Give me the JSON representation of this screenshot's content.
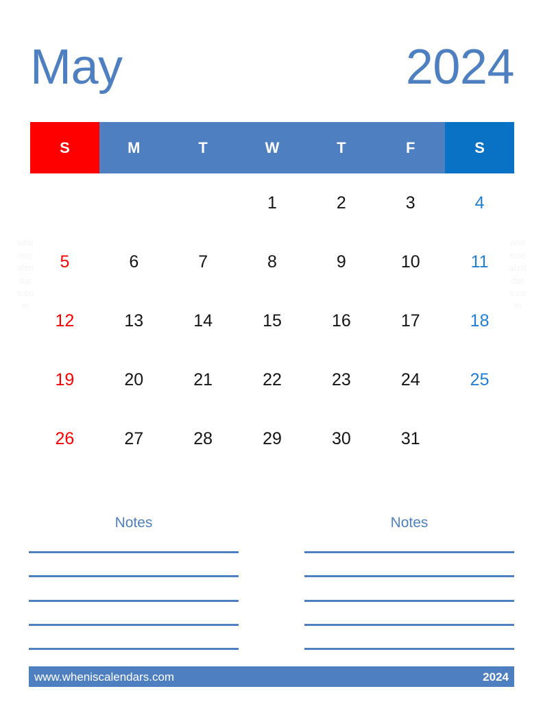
{
  "title": {
    "month": "May",
    "year": "2024"
  },
  "colors": {
    "primary_blue": "#4E7FC1",
    "saturday_header_blue": "#0A72C4",
    "sunday_red": "#FF0000",
    "saturday_text_blue": "#1E7FD4",
    "weekday_text": "#141414",
    "watermark": "#F4F4F4"
  },
  "weekdays": [
    {
      "label": "S",
      "kind": "sun"
    },
    {
      "label": "M",
      "kind": "weekday"
    },
    {
      "label": "T",
      "kind": "weekday"
    },
    {
      "label": "W",
      "kind": "weekday"
    },
    {
      "label": "T",
      "kind": "weekday"
    },
    {
      "label": "F",
      "kind": "weekday"
    },
    {
      "label": "S",
      "kind": "sat"
    }
  ],
  "weeks": [
    [
      {
        "day": "",
        "kind": "empty"
      },
      {
        "day": "",
        "kind": "empty"
      },
      {
        "day": "",
        "kind": "empty"
      },
      {
        "day": "1",
        "kind": "weekday"
      },
      {
        "day": "2",
        "kind": "weekday"
      },
      {
        "day": "3",
        "kind": "weekday"
      },
      {
        "day": "4",
        "kind": "sat"
      }
    ],
    [
      {
        "day": "5",
        "kind": "sun"
      },
      {
        "day": "6",
        "kind": "weekday"
      },
      {
        "day": "7",
        "kind": "weekday"
      },
      {
        "day": "8",
        "kind": "weekday"
      },
      {
        "day": "9",
        "kind": "weekday"
      },
      {
        "day": "10",
        "kind": "weekday"
      },
      {
        "day": "11",
        "kind": "sat"
      }
    ],
    [
      {
        "day": "12",
        "kind": "sun"
      },
      {
        "day": "13",
        "kind": "weekday"
      },
      {
        "day": "14",
        "kind": "weekday"
      },
      {
        "day": "15",
        "kind": "weekday"
      },
      {
        "day": "16",
        "kind": "weekday"
      },
      {
        "day": "17",
        "kind": "weekday"
      },
      {
        "day": "18",
        "kind": "sat"
      }
    ],
    [
      {
        "day": "19",
        "kind": "sun"
      },
      {
        "day": "20",
        "kind": "weekday"
      },
      {
        "day": "21",
        "kind": "weekday"
      },
      {
        "day": "22",
        "kind": "weekday"
      },
      {
        "day": "23",
        "kind": "weekday"
      },
      {
        "day": "24",
        "kind": "weekday"
      },
      {
        "day": "25",
        "kind": "sat"
      }
    ],
    [
      {
        "day": "26",
        "kind": "sun"
      },
      {
        "day": "27",
        "kind": "weekday"
      },
      {
        "day": "28",
        "kind": "weekday"
      },
      {
        "day": "29",
        "kind": "weekday"
      },
      {
        "day": "30",
        "kind": "weekday"
      },
      {
        "day": "31",
        "kind": "weekday"
      },
      {
        "day": "",
        "kind": "empty"
      }
    ]
  ],
  "notes": {
    "left_title": "Notes",
    "right_title": "Notes",
    "line_count": 5
  },
  "watermark": {
    "text": "wheniscalendars.com"
  },
  "footer": {
    "url": "www.wheniscalendars.com",
    "year": "2024"
  }
}
